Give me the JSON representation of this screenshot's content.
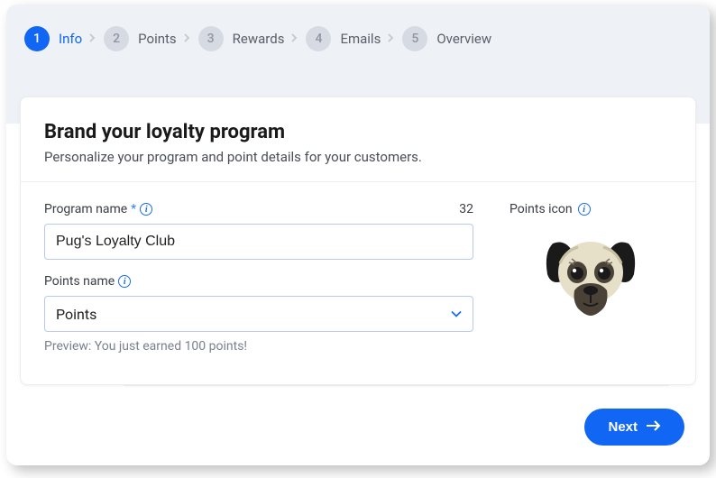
{
  "stepper": {
    "steps": [
      {
        "num": "1",
        "label": "Info"
      },
      {
        "num": "2",
        "label": "Points"
      },
      {
        "num": "3",
        "label": "Rewards"
      },
      {
        "num": "4",
        "label": "Emails"
      },
      {
        "num": "5",
        "label": "Overview"
      }
    ]
  },
  "card": {
    "title": "Brand your loyalty program",
    "subtitle": "Personalize your program and point details for your customers."
  },
  "fields": {
    "program_name": {
      "label": "Program name",
      "value": "Pug's Loyalty Club",
      "char_count": "32"
    },
    "points_name": {
      "label": "Points name",
      "value": "Points"
    },
    "preview": "Preview: You just earned 100 points!",
    "points_icon_label": "Points icon"
  },
  "footer": {
    "next": "Next"
  }
}
